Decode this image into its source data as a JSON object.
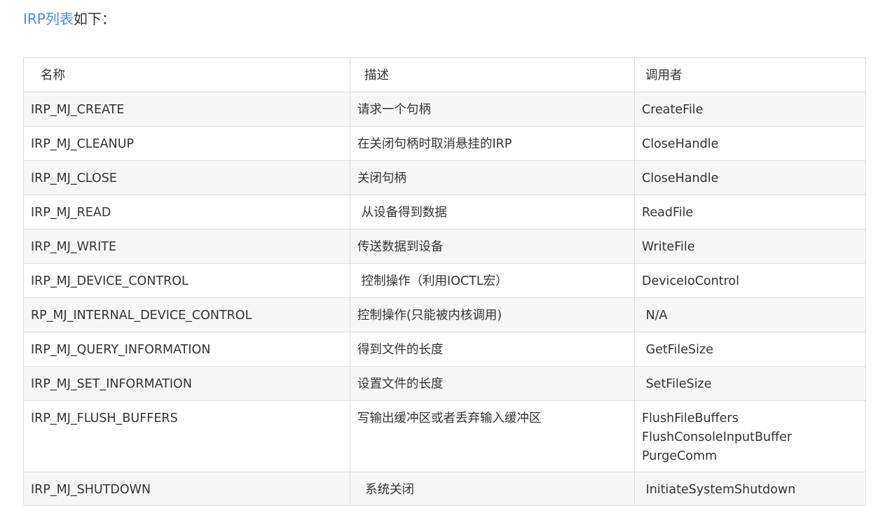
{
  "intro": {
    "link_text": "IRP列表",
    "rest_text": "如下："
  },
  "table": {
    "headers": [
      "名称",
      "描述",
      "调用者"
    ],
    "rows": [
      {
        "name": "IRP_MJ_CREATE",
        "desc": "请求一个句柄",
        "callers": [
          "CreateFile"
        ]
      },
      {
        "name": "IRP_MJ_CLEANUP",
        "desc": "在关闭句柄时取消悬挂的IRP",
        "callers": [
          "CloseHandle"
        ]
      },
      {
        "name": "IRP_MJ_CLOSE",
        "desc": "关闭句柄",
        "callers": [
          "CloseHandle"
        ]
      },
      {
        "name": "IRP_MJ_READ",
        "desc": " 从设备得到数据",
        "callers": [
          "ReadFile"
        ]
      },
      {
        "name": "IRP_MJ_WRITE",
        "desc": "传送数据到设备",
        "callers": [
          "WriteFile"
        ]
      },
      {
        "name": "IRP_MJ_DEVICE_CONTROL",
        "desc": " 控制操作（利用IOCTL宏）",
        "callers": [
          "DeviceIoControl"
        ]
      },
      {
        "name": "RP_MJ_INTERNAL_DEVICE_CONTROL",
        "desc": "控制操作(只能被内核调用)",
        "callers": [
          " N/A"
        ]
      },
      {
        "name": "IRP_MJ_QUERY_INFORMATION",
        "desc": "得到文件的长度",
        "callers": [
          " GetFileSize"
        ]
      },
      {
        "name": "IRP_MJ_SET_INFORMATION",
        "desc": "设置文件的长度",
        "callers": [
          " SetFileSize"
        ]
      },
      {
        "name": "IRP_MJ_FLUSH_BUFFERS",
        "desc": "写输出缓冲区或者丢弃输入缓冲区",
        "callers": [
          "FlushFileBuffers",
          "FlushConsoleInputBuffer",
          "PurgeComm"
        ]
      },
      {
        "name": "IRP_MJ_SHUTDOWN",
        "desc": "  系统关闭",
        "callers": [
          " InitiateSystemShutdown"
        ]
      }
    ]
  }
}
